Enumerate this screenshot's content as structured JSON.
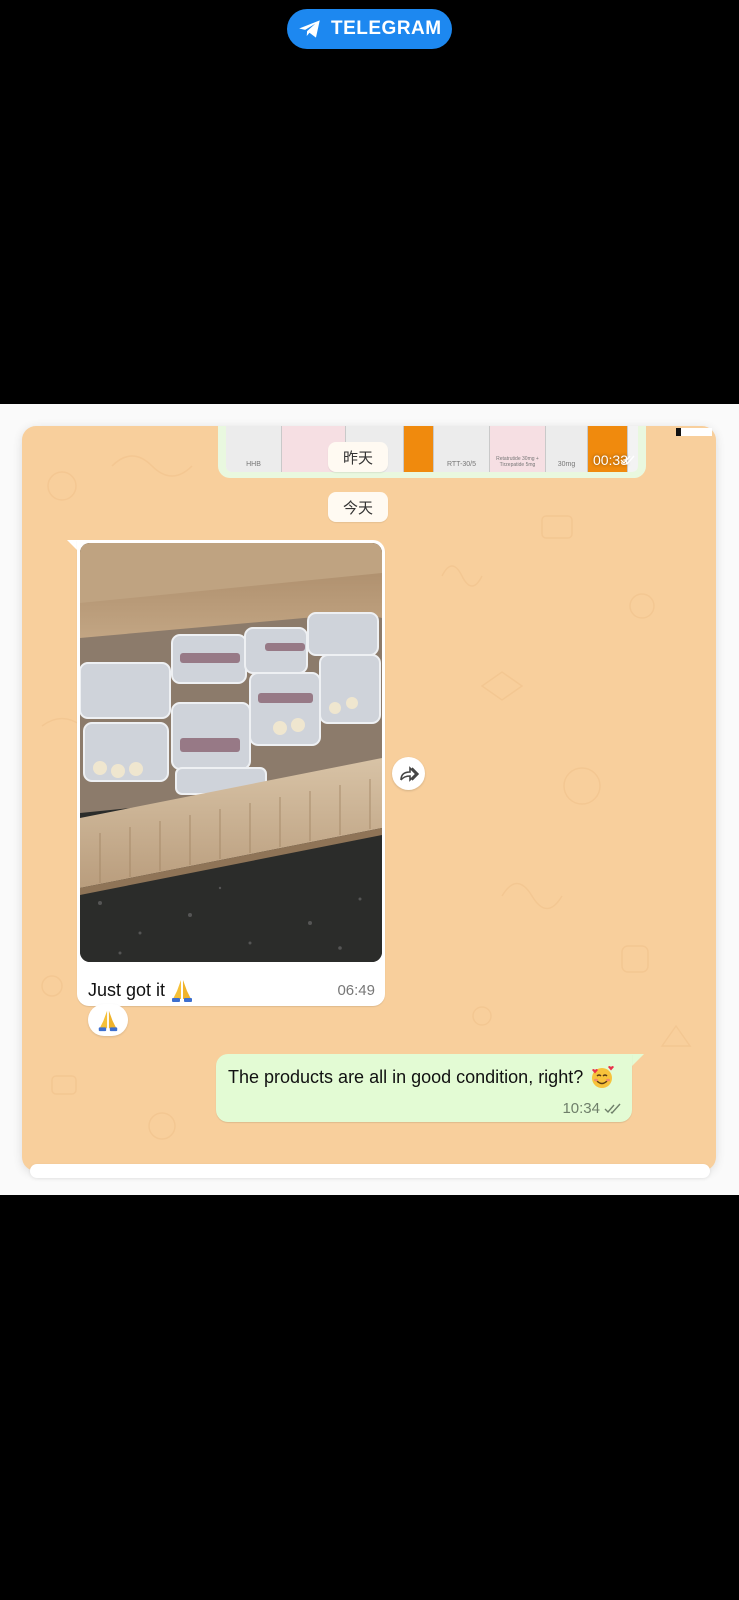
{
  "telegram_badge": {
    "label": "TELEGRAM",
    "icon": "paper-plane-icon",
    "color": "#1d88f0"
  },
  "chat": {
    "background_color": "#f8cf9c",
    "previous_message": {
      "time": "00:33",
      "status_icon": "double-check-icon",
      "strip_labels": [
        "HHB",
        "RTT-30/5",
        "Retatrutide 30mg + Tirzepatide 5mg",
        "30mg"
      ]
    },
    "date_separators": {
      "yesterday": "昨天",
      "today": "今天"
    },
    "incoming": {
      "photo_description_icon": "photo-of-vial-boxes",
      "caption": "Just got it",
      "caption_emoji": "folded-hands-emoji",
      "time": "06:49",
      "reaction_emoji": "folded-hands-emoji",
      "forward_icon": "forward-icon"
    },
    "outgoing": {
      "text": "The products are all in good condition, right?",
      "emoji": "smiling-face-with-hearts-emoji",
      "time": "10:34",
      "status_icon": "double-check-icon"
    }
  }
}
